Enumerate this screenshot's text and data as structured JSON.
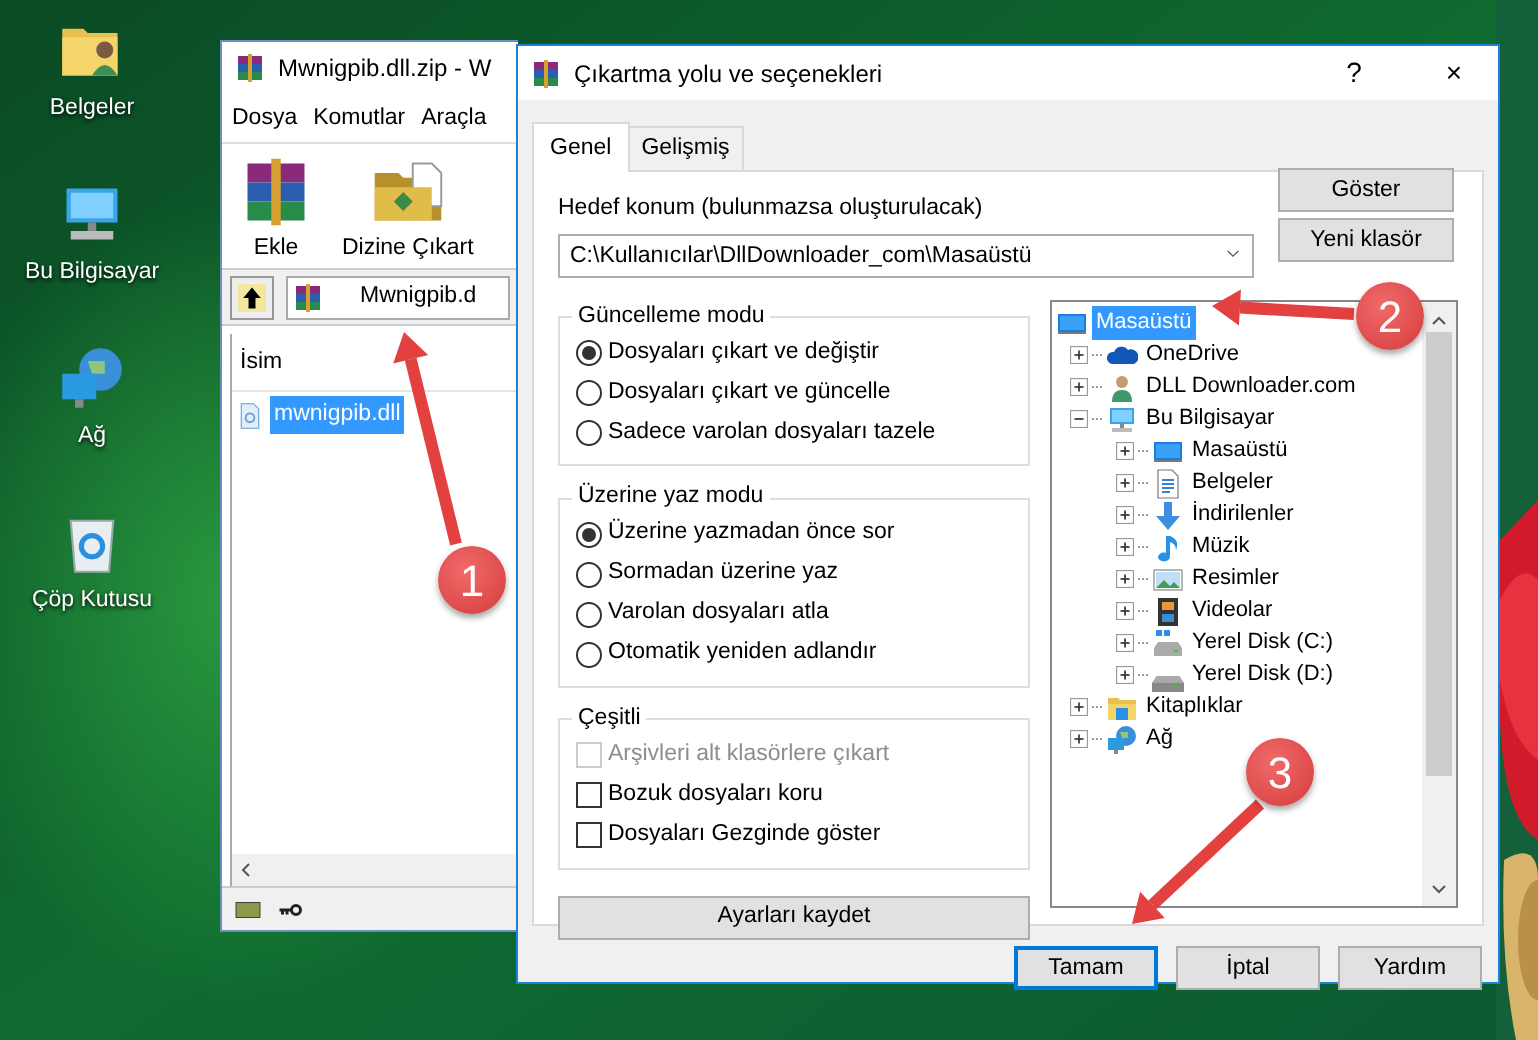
{
  "desktop_icons": [
    {
      "label": "Belgeler",
      "kind": "user-folder"
    },
    {
      "label": "Bu Bilgisayar",
      "kind": "computer"
    },
    {
      "label": "Ağ",
      "kind": "network"
    },
    {
      "label": "Çöp Kutusu",
      "kind": "recycle"
    }
  ],
  "archive_window": {
    "title": "Mwnigpib.dll.zip - W",
    "menu": [
      "Dosya",
      "Komutlar",
      "Araçla"
    ],
    "toolbar": [
      {
        "label": "Ekle",
        "kind": "add"
      },
      {
        "label": "Dizine Çıkart",
        "kind": "extract"
      }
    ],
    "path": "Mwnigpib.d",
    "columns": [
      "İsim"
    ],
    "files": [
      {
        "name": "mwnigpib.dll",
        "selected": true
      }
    ]
  },
  "dialog": {
    "title": "Çıkartma yolu ve seçenekleri",
    "title_buttons": [
      "?",
      "×"
    ],
    "tabs": [
      {
        "label": "Genel",
        "selected": true
      },
      {
        "label": "Gelişmiş",
        "selected": false
      }
    ],
    "destination": {
      "label": "Hedef konum (bulunmazsa oluşturulacak)",
      "value": "C:\\Kullanıcılar\\DllDownloader_com\\Masaüstü"
    },
    "side_buttons": [
      "Göster",
      "Yeni klasör"
    ],
    "groups": [
      {
        "title": "Güncelleme modu",
        "options": [
          {
            "kind": "radio",
            "label": "Dosyaları çıkart ve değiştir",
            "checked": true,
            "disabled": false
          },
          {
            "kind": "radio",
            "label": "Dosyaları çıkart ve güncelle",
            "checked": false,
            "disabled": false
          },
          {
            "kind": "radio",
            "label": "Sadece varolan dosyaları tazele",
            "checked": false,
            "disabled": false
          }
        ]
      },
      {
        "title": "Üzerine yaz modu",
        "options": [
          {
            "kind": "radio",
            "label": "Üzerine yazmadan önce sor",
            "checked": true,
            "disabled": false
          },
          {
            "kind": "radio",
            "label": "Sormadan üzerine yaz",
            "checked": false,
            "disabled": false
          },
          {
            "kind": "radio",
            "label": "Varolan dosyaları atla",
            "checked": false,
            "disabled": false
          },
          {
            "kind": "radio",
            "label": "Otomatik yeniden adlandır",
            "checked": false,
            "disabled": false
          }
        ]
      },
      {
        "title": "Çeşitli",
        "options": [
          {
            "kind": "checkbox",
            "label": "Arşivleri alt klasörlere çıkart",
            "checked": false,
            "disabled": true
          },
          {
            "kind": "checkbox",
            "label": "Bozuk dosyaları koru",
            "checked": false,
            "disabled": false
          },
          {
            "kind": "checkbox",
            "label": "Dosyaları Gezginde göster",
            "checked": false,
            "disabled": false
          }
        ]
      }
    ],
    "save_button": "Ayarları kaydet",
    "tree": [
      {
        "label": "Masaüstü",
        "kind": "desktop",
        "selected": true,
        "children": [
          {
            "label": "OneDrive",
            "kind": "cloud",
            "selected": false,
            "expanded": false
          },
          {
            "label": "DLL Downloader.com",
            "kind": "person",
            "selected": false,
            "expanded": false
          },
          {
            "label": "Bu Bilgisayar",
            "kind": "computer",
            "selected": false,
            "expanded": true,
            "children": [
              {
                "label": "Masaüstü",
                "kind": "desktop",
                "selected": false,
                "expanded": false
              },
              {
                "label": "Belgeler",
                "kind": "documents",
                "selected": false,
                "expanded": false
              },
              {
                "label": "İndirilenler",
                "kind": "downloads",
                "selected": false,
                "expanded": false
              },
              {
                "label": "Müzik",
                "kind": "music",
                "selected": false,
                "expanded": false
              },
              {
                "label": "Resimler",
                "kind": "pictures",
                "selected": false,
                "expanded": false
              },
              {
                "label": "Videolar",
                "kind": "videos",
                "selected": false,
                "expanded": false
              },
              {
                "label": "Yerel Disk (C:)",
                "kind": "system-drive",
                "selected": false,
                "expanded": false
              },
              {
                "label": "Yerel Disk (D:)",
                "kind": "drive",
                "selected": false,
                "expanded": false
              }
            ]
          },
          {
            "label": "Kitaplıklar",
            "kind": "libraries",
            "selected": false,
            "expanded": false
          },
          {
            "label": "Ağ",
            "kind": "network",
            "selected": false,
            "expanded": false
          }
        ]
      }
    ],
    "buttons": [
      {
        "label": "Tamam",
        "default": true
      },
      {
        "label": "İptal",
        "default": false
      },
      {
        "label": "Yardım",
        "default": false
      }
    ]
  },
  "callouts": [
    {
      "number": "1"
    },
    {
      "number": "2"
    },
    {
      "number": "3"
    }
  ]
}
